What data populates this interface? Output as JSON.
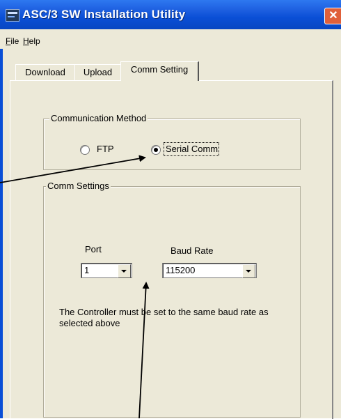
{
  "window": {
    "title": "ASC/3 SW Installation Utility",
    "close_glyph": "✕"
  },
  "menu": {
    "file": {
      "accel": "F",
      "rest": "ile"
    },
    "help": {
      "accel": "H",
      "rest": "elp"
    }
  },
  "tabs": {
    "download": "Download",
    "upload": "Upload",
    "comm_setting": "Comm Setting",
    "active": "Comm Setting"
  },
  "communication_method": {
    "title": "Communication Method",
    "options": [
      "FTP",
      "Serial Comm"
    ],
    "selected": "Serial Comm"
  },
  "comm_settings": {
    "title": "Comm Settings",
    "port": {
      "label": "Port",
      "value": "1"
    },
    "baud_rate": {
      "label": "Baud Rate",
      "value": "115200"
    },
    "note": "The Controller must be set to the same baud rate as selected above"
  },
  "colors": {
    "titlebar": "#0a4fd6",
    "window_bg": "#ece9d8",
    "close_button": "#e0603a"
  },
  "icons": [
    "app-icon",
    "close-icon",
    "chevron-down-icon",
    "annotation-arrow"
  ]
}
